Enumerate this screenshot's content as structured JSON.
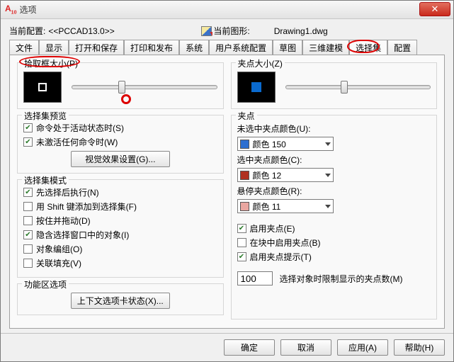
{
  "window": {
    "title": "选项"
  },
  "header": {
    "profile_label": "当前配置:",
    "profile_value": "<<PCCAD13.0>>",
    "drawing_label": "当前图形:",
    "drawing_value": "Drawing1.dwg"
  },
  "tabs": [
    "文件",
    "显示",
    "打开和保存",
    "打印和发布",
    "系统",
    "用户系统配置",
    "草图",
    "三维建模",
    "选择集",
    "配置"
  ],
  "active_tab_index": 8,
  "left": {
    "pickbox": {
      "title": "拾取框大小(P)"
    },
    "preview": {
      "title": "选择集预览",
      "chk_active": "命令处于活动状态时(S)",
      "chk_noactive": "未激活任何命令时(W)",
      "btn_visual": "视觉效果设置(G)..."
    },
    "mode": {
      "title": "选择集模式",
      "chk_pre": "先选择后执行(N)",
      "chk_shift": "用 Shift 键添加到选择集(F)",
      "chk_pressdrag": "按住并拖动(D)",
      "chk_implied": "隐含选择窗口中的对象(I)",
      "chk_group": "对象编组(O)",
      "chk_hatch": "关联填充(V)"
    },
    "ribbon": {
      "title": "功能区选项",
      "btn_ctx": "上下文选项卡状态(X)..."
    }
  },
  "right": {
    "gripsize": {
      "title": "夹点大小(Z)"
    },
    "grips": {
      "title": "夹点",
      "unsel_label": "未选中夹点颜色(U):",
      "unsel_val": "颜色 150",
      "unsel_hex": "#2d6fd0",
      "sel_label": "选中夹点颜色(C):",
      "sel_val": "颜色 12",
      "sel_hex": "#b03020",
      "hover_label": "悬停夹点颜色(R):",
      "hover_val": "颜色 11",
      "hover_hex": "#e9a6a0",
      "chk_enable": "启用夹点(E)",
      "chk_inblock": "在块中启用夹点(B)",
      "chk_tips": "启用夹点提示(T)",
      "count_val": "100",
      "count_label": "选择对象时限制显示的夹点数(M)"
    }
  },
  "buttons": {
    "ok": "确定",
    "cancel": "取消",
    "apply": "应用(A)",
    "help": "帮助(H)"
  }
}
